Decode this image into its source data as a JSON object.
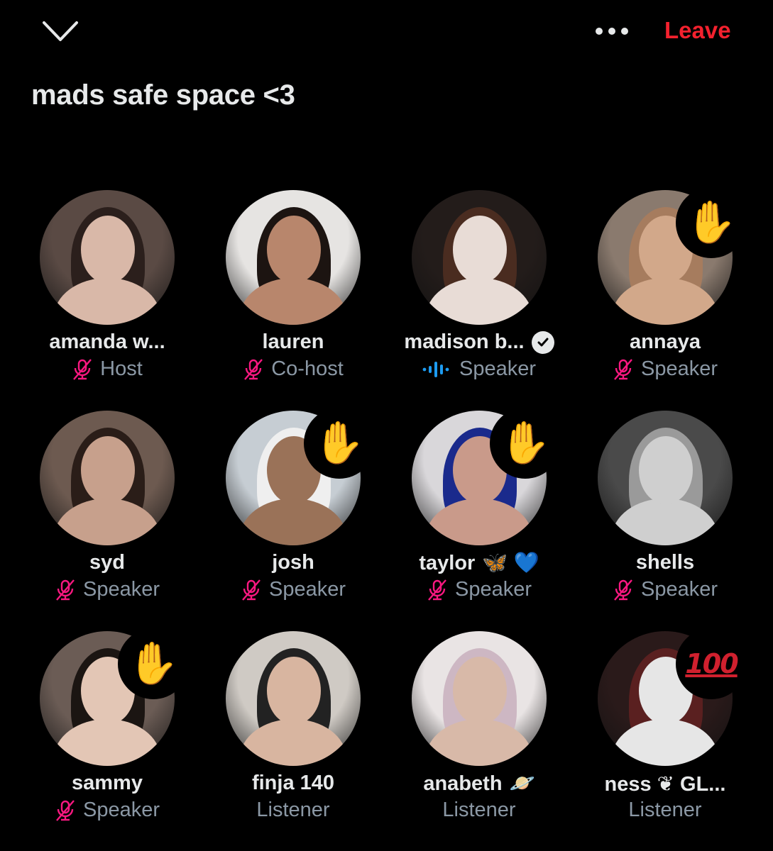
{
  "header": {
    "collapse_icon": "chevron-down-icon",
    "more_icon": "more-horizontal-icon",
    "leave_label": "Leave",
    "leave_color": "#f4212e"
  },
  "space": {
    "title": "mads safe space <3"
  },
  "participants": [
    {
      "name": "amanda w...",
      "role": "Host",
      "status_icon": "mic-off-icon",
      "reaction": "",
      "colors": [
        "#5a4a44",
        "#2b1f1c",
        "#d9b8a8"
      ]
    },
    {
      "name": "lauren",
      "role": "Co-host",
      "status_icon": "mic-off-icon",
      "reaction": "",
      "colors": [
        "#e6e4e2",
        "#1c1411",
        "#b8866c"
      ]
    },
    {
      "name": "madison b...",
      "role": "Speaker",
      "status_icon": "audio-wave-icon",
      "verified": true,
      "reaction": "",
      "colors": [
        "#231c1a",
        "#4a2c20",
        "#e8dcd6"
      ]
    },
    {
      "name": "annaya",
      "role": "Speaker",
      "status_icon": "mic-off-icon",
      "reaction": "✋",
      "colors": [
        "#8a7a6e",
        "#a67c5e",
        "#d2a88a"
      ]
    },
    {
      "name": "syd",
      "role": "Speaker",
      "status_icon": "mic-off-icon",
      "reaction": "",
      "colors": [
        "#6d5a50",
        "#2a1d18",
        "#c7a08c"
      ]
    },
    {
      "name": "josh",
      "role": "Speaker",
      "status_icon": "mic-off-icon",
      "reaction": "✋",
      "colors": [
        "#c6cdd3",
        "#efefef",
        "#9a7258"
      ]
    },
    {
      "name": "taylor",
      "name_emoji": "🦋 💙",
      "role": "Speaker",
      "status_icon": "mic-off-icon",
      "reaction": "✋",
      "colors": [
        "#d9d7da",
        "#1a2a8c",
        "#c99a8a"
      ]
    },
    {
      "name": "shells",
      "role": "Speaker",
      "status_icon": "mic-off-icon",
      "reaction": "",
      "colors": [
        "#4a4a4a",
        "#9a9a9a",
        "#cfcfcf"
      ]
    },
    {
      "name": "sammy",
      "role": "Speaker",
      "status_icon": "mic-off-icon",
      "reaction": "✋",
      "colors": [
        "#6b5c55",
        "#1b1512",
        "#e3c6b5"
      ]
    },
    {
      "name": "finja 140",
      "role": "Listener",
      "status_icon": "",
      "reaction": "",
      "colors": [
        "#cfcac4",
        "#222",
        "#d8b5a0"
      ]
    },
    {
      "name": "anabeth",
      "name_emoji": "🪐",
      "role": "Listener",
      "status_icon": "",
      "reaction": "",
      "colors": [
        "#e9e4e4",
        "#cdb7c3",
        "#d8b9a8"
      ]
    },
    {
      "name": "ness ❦ GL...",
      "role": "Listener",
      "status_icon": "",
      "reaction": "💯",
      "colors": [
        "#2a1a1a",
        "#5a2020",
        "#e6e6e6"
      ]
    }
  ],
  "colors": {
    "muted_icon": "#f91880",
    "speaking_wave": "#1d9bf0",
    "text_primary": "#e7e9ea",
    "text_secondary": "#8b98a5"
  }
}
